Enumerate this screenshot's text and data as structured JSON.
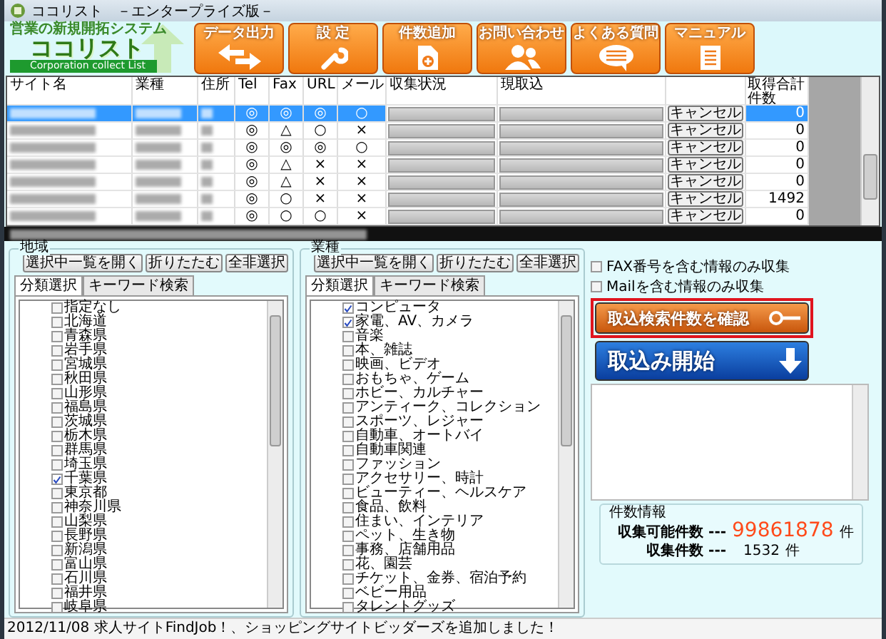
{
  "window": {
    "title": "ココリスト　－エンタープライズ版－"
  },
  "logo": {
    "tagline": "営業の新規開拓システム",
    "name": "ココリスト",
    "subtitle": "Corporation collect List"
  },
  "toolbar": [
    {
      "label": "データ出力",
      "kind": "export"
    },
    {
      "label": "設 定",
      "kind": "settings"
    },
    {
      "label": "件数追加",
      "kind": "add"
    },
    {
      "label": "お問い合わせ",
      "kind": "contact"
    },
    {
      "label": "よくある質問",
      "kind": "faq"
    },
    {
      "label": "マニュアル",
      "kind": "manual"
    }
  ],
  "table": {
    "columns": [
      "サイト名",
      "業種",
      "住所",
      "Tel",
      "Fax",
      "URL",
      "メール",
      "収集状況",
      "現取込",
      "取得合計件数"
    ],
    "rows": [
      {
        "selected": true,
        "tel": "◎",
        "fax": "◎",
        "url": "◎",
        "mail": "○",
        "cancel": "キャンセル",
        "count": "0"
      },
      {
        "selected": false,
        "tel": "◎",
        "fax": "△",
        "url": "○",
        "mail": "×",
        "cancel": "キャンセル",
        "count": "0"
      },
      {
        "selected": false,
        "tel": "◎",
        "fax": "◎",
        "url": "◎",
        "mail": "○",
        "cancel": "キャンセル",
        "count": "0"
      },
      {
        "selected": false,
        "tel": "◎",
        "fax": "△",
        "url": "×",
        "mail": "×",
        "cancel": "キャンセル",
        "count": "0"
      },
      {
        "selected": false,
        "tel": "◎",
        "fax": "△",
        "url": "×",
        "mail": "×",
        "cancel": "キャンセル",
        "count": "0"
      },
      {
        "selected": false,
        "tel": "◎",
        "fax": "○",
        "url": "×",
        "mail": "×",
        "cancel": "キャンセル",
        "count": "1492"
      },
      {
        "selected": false,
        "tel": "◎",
        "fax": "○",
        "url": "○",
        "mail": "×",
        "cancel": "キャンセル",
        "count": "0"
      }
    ]
  },
  "panels": [
    {
      "legend": "地域",
      "buttons": [
        "選択中一覧を開く",
        "折りたたむ",
        "全非選択"
      ],
      "tabs": [
        {
          "label": "分類選択",
          "selected": true
        },
        {
          "label": "キーワード検索",
          "selected": false
        }
      ],
      "items": [
        {
          "label": "指定なし",
          "checked": false
        },
        {
          "label": "北海道",
          "checked": false
        },
        {
          "label": "青森県",
          "checked": false
        },
        {
          "label": "岩手県",
          "checked": false
        },
        {
          "label": "宮城県",
          "checked": false
        },
        {
          "label": "秋田県",
          "checked": false
        },
        {
          "label": "山形県",
          "checked": false
        },
        {
          "label": "福島県",
          "checked": false
        },
        {
          "label": "茨城県",
          "checked": false
        },
        {
          "label": "栃木県",
          "checked": false
        },
        {
          "label": "群馬県",
          "checked": false
        },
        {
          "label": "埼玉県",
          "checked": false
        },
        {
          "label": "千葉県",
          "checked": true
        },
        {
          "label": "東京都",
          "checked": false
        },
        {
          "label": "神奈川県",
          "checked": false
        },
        {
          "label": "山梨県",
          "checked": false
        },
        {
          "label": "長野県",
          "checked": false
        },
        {
          "label": "新潟県",
          "checked": false
        },
        {
          "label": "富山県",
          "checked": false
        },
        {
          "label": "石川県",
          "checked": false
        },
        {
          "label": "福井県",
          "checked": false
        },
        {
          "label": "岐阜県",
          "checked": false
        }
      ]
    },
    {
      "legend": "業種",
      "buttons": [
        "選択中一覧を開く",
        "折りたたむ",
        "全非選択"
      ],
      "tabs": [
        {
          "label": "分類選択",
          "selected": true
        },
        {
          "label": "キーワード検索",
          "selected": false
        }
      ],
      "items": [
        {
          "label": "コンピュータ",
          "checked": true
        },
        {
          "label": "家電、AV、カメラ",
          "checked": true
        },
        {
          "label": "音楽",
          "checked": false
        },
        {
          "label": "本、雑誌",
          "checked": false
        },
        {
          "label": "映画、ビデオ",
          "checked": false
        },
        {
          "label": "おもちゃ、ゲーム",
          "checked": false
        },
        {
          "label": "ホビー、カルチャー",
          "checked": false
        },
        {
          "label": "アンティーク、コレクション",
          "checked": false
        },
        {
          "label": "スポーツ、レジャー",
          "checked": false
        },
        {
          "label": "自動車、オートバイ",
          "checked": false
        },
        {
          "label": "自動車関連",
          "checked": false
        },
        {
          "label": "ファッション",
          "checked": false
        },
        {
          "label": "アクセサリー、時計",
          "checked": false
        },
        {
          "label": "ビューティー、ヘルスケア",
          "checked": false
        },
        {
          "label": "食品、飲料",
          "checked": false
        },
        {
          "label": "住まい、インテリア",
          "checked": false
        },
        {
          "label": "ペット、生き物",
          "checked": false
        },
        {
          "label": "事務、店舗用品",
          "checked": false
        },
        {
          "label": "花、園芸",
          "checked": false
        },
        {
          "label": "チケット、金券、宿泊予約",
          "checked": false
        },
        {
          "label": "ベビー用品",
          "checked": false
        },
        {
          "label": "タレントグッズ",
          "checked": false
        }
      ]
    }
  ],
  "options": [
    {
      "label": "FAX番号を含む情報のみ収集",
      "checked": false
    },
    {
      "label": "Mailを含む情報のみ収集",
      "checked": false
    }
  ],
  "check_button": {
    "label": "取込検索件数を確認"
  },
  "start_button": {
    "label": "取込み開始"
  },
  "counts": {
    "legend": "件数情報",
    "rows": [
      {
        "label": "収集可能件数 ---",
        "value": "99861878",
        "unit": "件",
        "kind": "highlight"
      },
      {
        "label": "収集件数 ---",
        "value": "1532",
        "unit": "件",
        "kind": "plain"
      }
    ]
  },
  "status_bar": {
    "text": "2012/11/08 求人サイトFindJob！、ショッピングサイトビッダーズを追加しました！"
  }
}
